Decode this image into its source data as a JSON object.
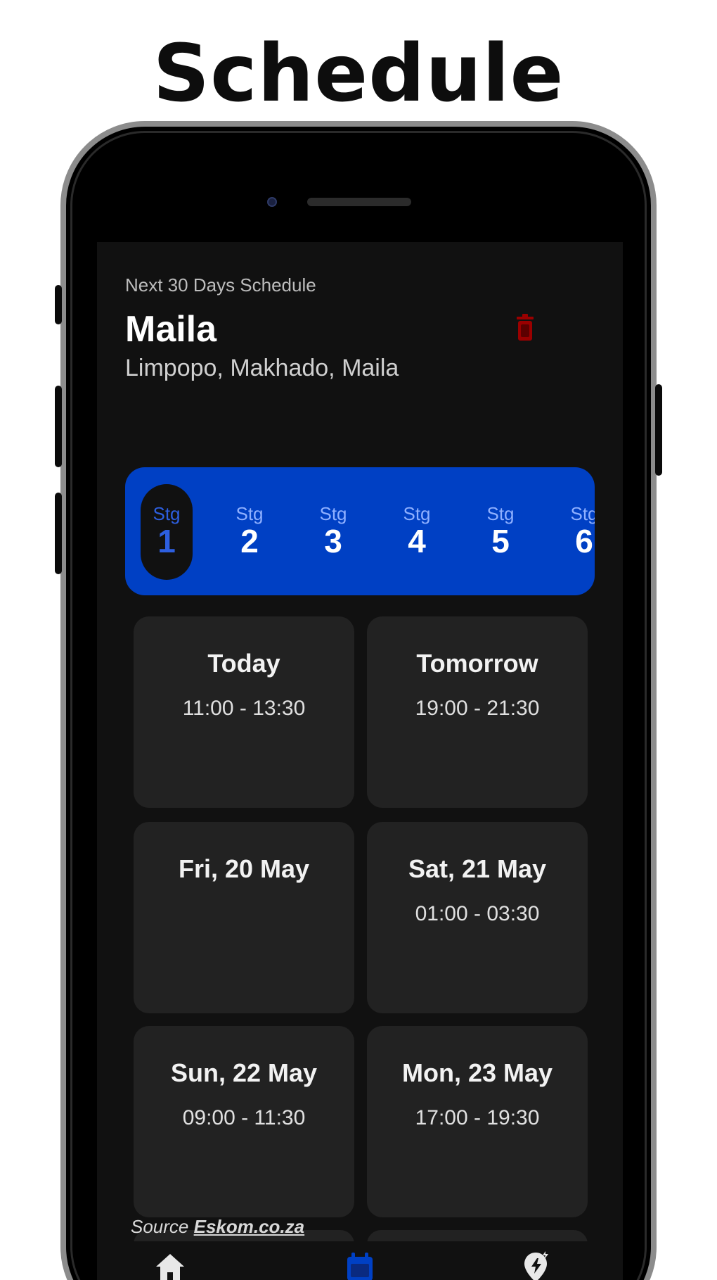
{
  "promo": {
    "title": "Schedule"
  },
  "header": {
    "subtitle": "Next 30 Days Schedule",
    "area_name": "Maila",
    "area_path": "Limpopo, Makhado, Maila"
  },
  "colors": {
    "accent": "#0040c4",
    "background": "#111111",
    "card": "#222222",
    "delete": "#9a0000"
  },
  "stages": {
    "selected": 1,
    "items": [
      {
        "label": "Stg",
        "number": "1"
      },
      {
        "label": "Stg",
        "number": "2"
      },
      {
        "label": "Stg",
        "number": "3"
      },
      {
        "label": "Stg",
        "number": "4"
      },
      {
        "label": "Stg",
        "number": "5"
      },
      {
        "label": "Stg",
        "number": "6"
      }
    ]
  },
  "days": [
    {
      "title": "Today",
      "time": "11:00 - 13:30"
    },
    {
      "title": "Tomorrow",
      "time": "19:00 - 21:30"
    },
    {
      "title": "Fri, 20 May",
      "time": ""
    },
    {
      "title": "Sat, 21 May",
      "time": "01:00 - 03:30"
    },
    {
      "title": "Sun, 22 May",
      "time": "09:00 - 11:30"
    },
    {
      "title": "Mon, 23 May",
      "time": "17:00 - 19:30"
    }
  ],
  "source": {
    "prefix": "Source ",
    "link": "Eskom.co.za"
  },
  "nav": {
    "items": [
      {
        "icon": "home-icon"
      },
      {
        "icon": "calendar-icon"
      },
      {
        "icon": "power-pin-icon"
      }
    ],
    "active": "calendar-icon"
  }
}
